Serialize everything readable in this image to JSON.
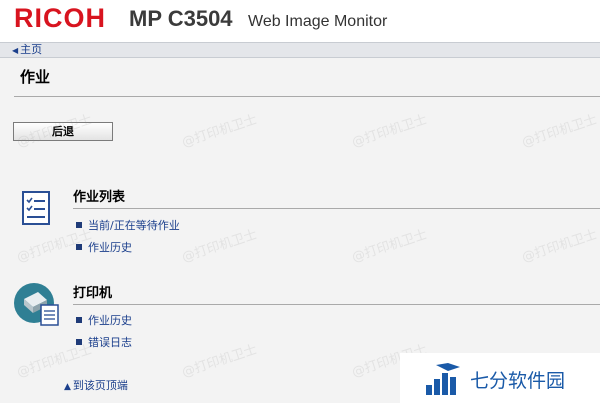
{
  "header": {
    "logo": "RICOH",
    "model": "MP C3504",
    "product": "Web Image Monitor"
  },
  "nav": {
    "home_label": "主页"
  },
  "page": {
    "title": "作业",
    "back_button": "后退"
  },
  "sections": [
    {
      "title": "作业列表",
      "icon": "job-list-icon",
      "links": [
        "当前/正在等待作业",
        "作业历史"
      ]
    },
    {
      "title": "打印机",
      "icon": "printer-icon",
      "links": [
        "作业历史",
        "错误日志"
      ]
    }
  ],
  "footer": {
    "top_link": "到该页顶端"
  },
  "watermark": {
    "text": "@打印机卫士"
  },
  "brand": {
    "text": "七分软件园",
    "icon": "bar-logo-icon"
  },
  "colors": {
    "logo_red": "#d8141f",
    "link_blue": "#1b3f8c",
    "brand_blue": "#1a5aa8"
  }
}
